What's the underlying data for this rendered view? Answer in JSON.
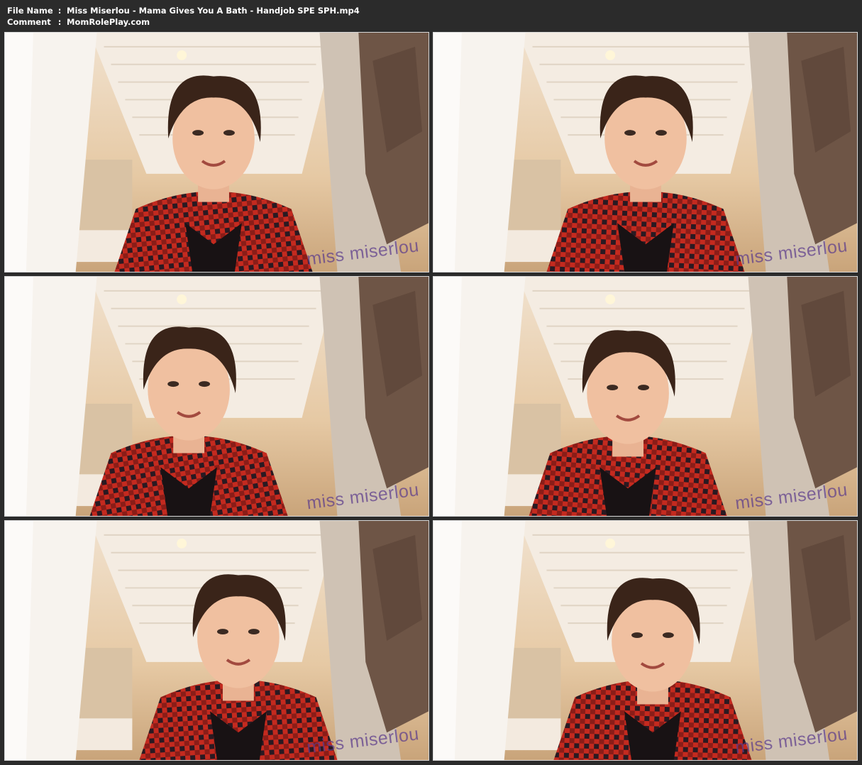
{
  "header": {
    "file_name_label": "File Name",
    "file_name_value": "Miss Miserlou - Mama Gives You A Bath - Handjob SPE SPH.mp4",
    "comment_label": "Comment",
    "comment_value": "MomRolePlay.com",
    "separator": ":"
  },
  "thumbnails": [
    {
      "watermark": "miss miserlou"
    },
    {
      "watermark": "miss miserlou"
    },
    {
      "watermark": "miss miserlou"
    },
    {
      "watermark": "miss miserlou"
    },
    {
      "watermark": "miss miserlou"
    },
    {
      "watermark": "miss miserlou"
    }
  ],
  "colors": {
    "background": "#2b2b2b",
    "text": "#ffffff",
    "watermark": "#5c3c8c",
    "shirt_red": "#c42a1f",
    "shirt_dark": "#2a1a22"
  }
}
